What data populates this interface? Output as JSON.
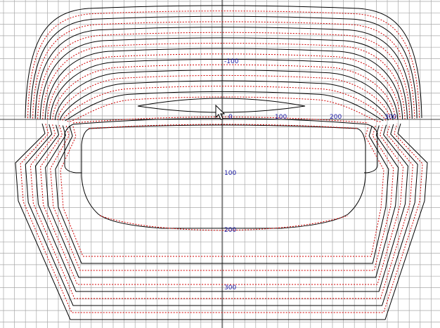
{
  "drawing": {
    "axis_labels": {
      "x_zero": "0",
      "x_100": "100",
      "x_200": "200",
      "x_300": "300",
      "y_neg100": "-100",
      "y_100": "100",
      "y_200": "200",
      "y_300": "300"
    },
    "colors": {
      "background": "#ffffff",
      "grid": "#a8a8a8",
      "axis": "#404040",
      "contour_black": "#000000",
      "contour_red": "#d00000",
      "label": "#1a1aa8"
    },
    "icons": {
      "cursor": "mouse-pointer-icon"
    }
  }
}
